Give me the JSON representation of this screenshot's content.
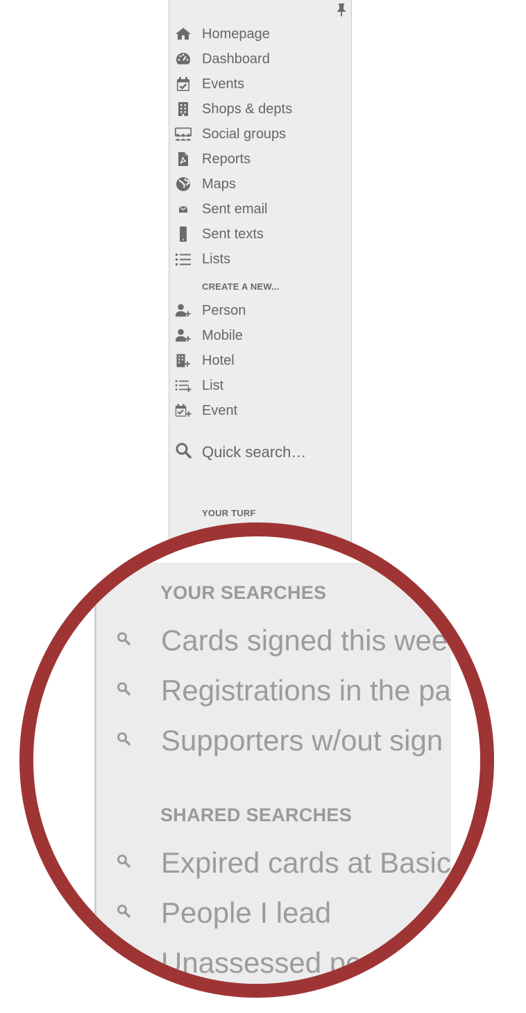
{
  "colors": {
    "panel_bg": "#ededed",
    "text": "#666666",
    "icon": "#6b6b6b",
    "lens_ring": "#9e3534"
  },
  "sidebar": {
    "pin_icon": "pin-icon",
    "items": [
      {
        "label": "Homepage",
        "icon": "home-icon"
      },
      {
        "label": "Dashboard",
        "icon": "dashboard-icon"
      },
      {
        "label": "Events",
        "icon": "calendar-check-icon"
      },
      {
        "label": "Shops & depts",
        "icon": "building-icon"
      },
      {
        "label": "Social groups",
        "icon": "group-icon"
      },
      {
        "label": "Reports",
        "icon": "pdf-file-icon"
      },
      {
        "label": "Maps",
        "icon": "globe-icon"
      },
      {
        "label": "Sent email",
        "icon": "envelope-icon"
      },
      {
        "label": "Sent texts",
        "icon": "mobile-icon"
      },
      {
        "label": "Lists",
        "icon": "list-icon"
      }
    ],
    "create_heading": "CREATE A NEW...",
    "create_items": [
      {
        "label": "Person",
        "icon": "add-person-icon"
      },
      {
        "label": "Mobile",
        "icon": "add-mobile-icon"
      },
      {
        "label": "Hotel",
        "icon": "add-building-icon"
      },
      {
        "label": "List",
        "icon": "add-list-icon"
      },
      {
        "label": "Event",
        "icon": "add-event-icon"
      }
    ],
    "quick_search": "Quick search…",
    "turf_heading": "YOUR TURF"
  },
  "magnified": {
    "your_searches_heading": "YOUR SEARCHES",
    "your_searches": [
      "Cards signed this wee",
      "Registrations in the pa",
      "Supporters w/out sign"
    ],
    "shared_searches_heading": "SHARED SEARCHES",
    "shared_searches": [
      "Expired cards at Basic",
      "People I lead",
      "Unassessed peopl"
    ]
  }
}
